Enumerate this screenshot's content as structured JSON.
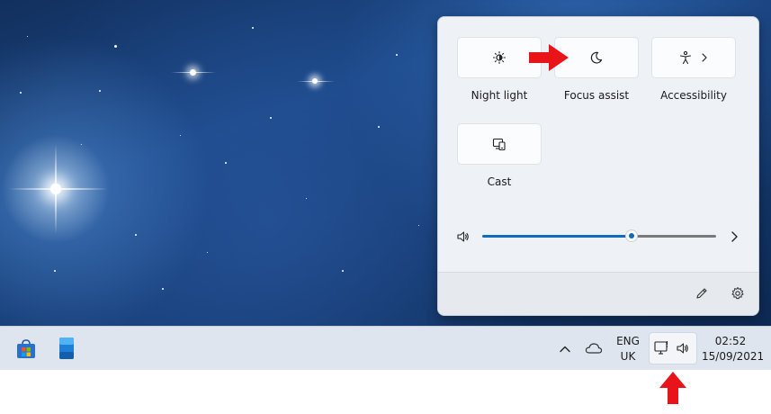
{
  "quick_settings": {
    "tiles": [
      {
        "label": "Night light",
        "icon": "brightness-icon"
      },
      {
        "label": "Focus assist",
        "icon": "moon-icon"
      },
      {
        "label": "Accessibility",
        "icon": "accessibility-icon"
      },
      {
        "label": "Cast",
        "icon": "cast-icon"
      }
    ],
    "volume": {
      "level": 0.64,
      "icon": "speaker-icon"
    },
    "footer": {
      "edit_icon": "pencil-icon",
      "settings_icon": "gear-icon"
    }
  },
  "taskbar": {
    "pinned": [
      {
        "name": "store-icon"
      },
      {
        "name": "file-icon"
      }
    ],
    "language": {
      "line1": "ENG",
      "line2": "UK"
    },
    "clock": {
      "time": "02:52",
      "date": "15/09/2021"
    }
  },
  "colors": {
    "accent": "#0f6cbd",
    "arrow": "#e8141a"
  }
}
